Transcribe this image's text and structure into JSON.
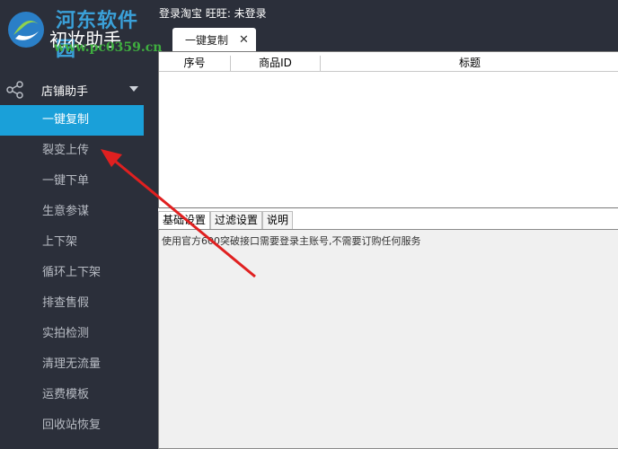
{
  "app": {
    "title": "初妆助手"
  },
  "watermark": {
    "text": "河东软件园",
    "url": "www.pc0359.cn"
  },
  "topbar": {
    "login_status": "登录淘宝 旺旺: 未登录"
  },
  "tabs": [
    {
      "label": "一键复制",
      "close": "✕"
    }
  ],
  "sidebar": {
    "section": {
      "label": "店铺助手",
      "icon": "share-icon"
    },
    "items": [
      {
        "label": "一键复制",
        "active": true
      },
      {
        "label": "裂变上传"
      },
      {
        "label": "一键下单"
      },
      {
        "label": "生意参谋"
      },
      {
        "label": "上下架"
      },
      {
        "label": "循环上下架"
      },
      {
        "label": "排查售假"
      },
      {
        "label": "实拍检测"
      },
      {
        "label": "清理无流量"
      },
      {
        "label": "运费模板"
      },
      {
        "label": "回收站恢复"
      }
    ]
  },
  "table": {
    "columns": [
      "序号",
      "商品ID",
      "标题"
    ]
  },
  "subtabs": [
    {
      "label": "基础设置"
    },
    {
      "label": "过滤设置"
    },
    {
      "label": "说明"
    }
  ],
  "settings": {
    "description": "使用官方600突破接口需要登录主账号,不需要订购任何服务"
  },
  "colors": {
    "sidebar_bg": "#2b2f3a",
    "active_item": "#1aa0d9",
    "annotation_arrow": "#e02020"
  }
}
